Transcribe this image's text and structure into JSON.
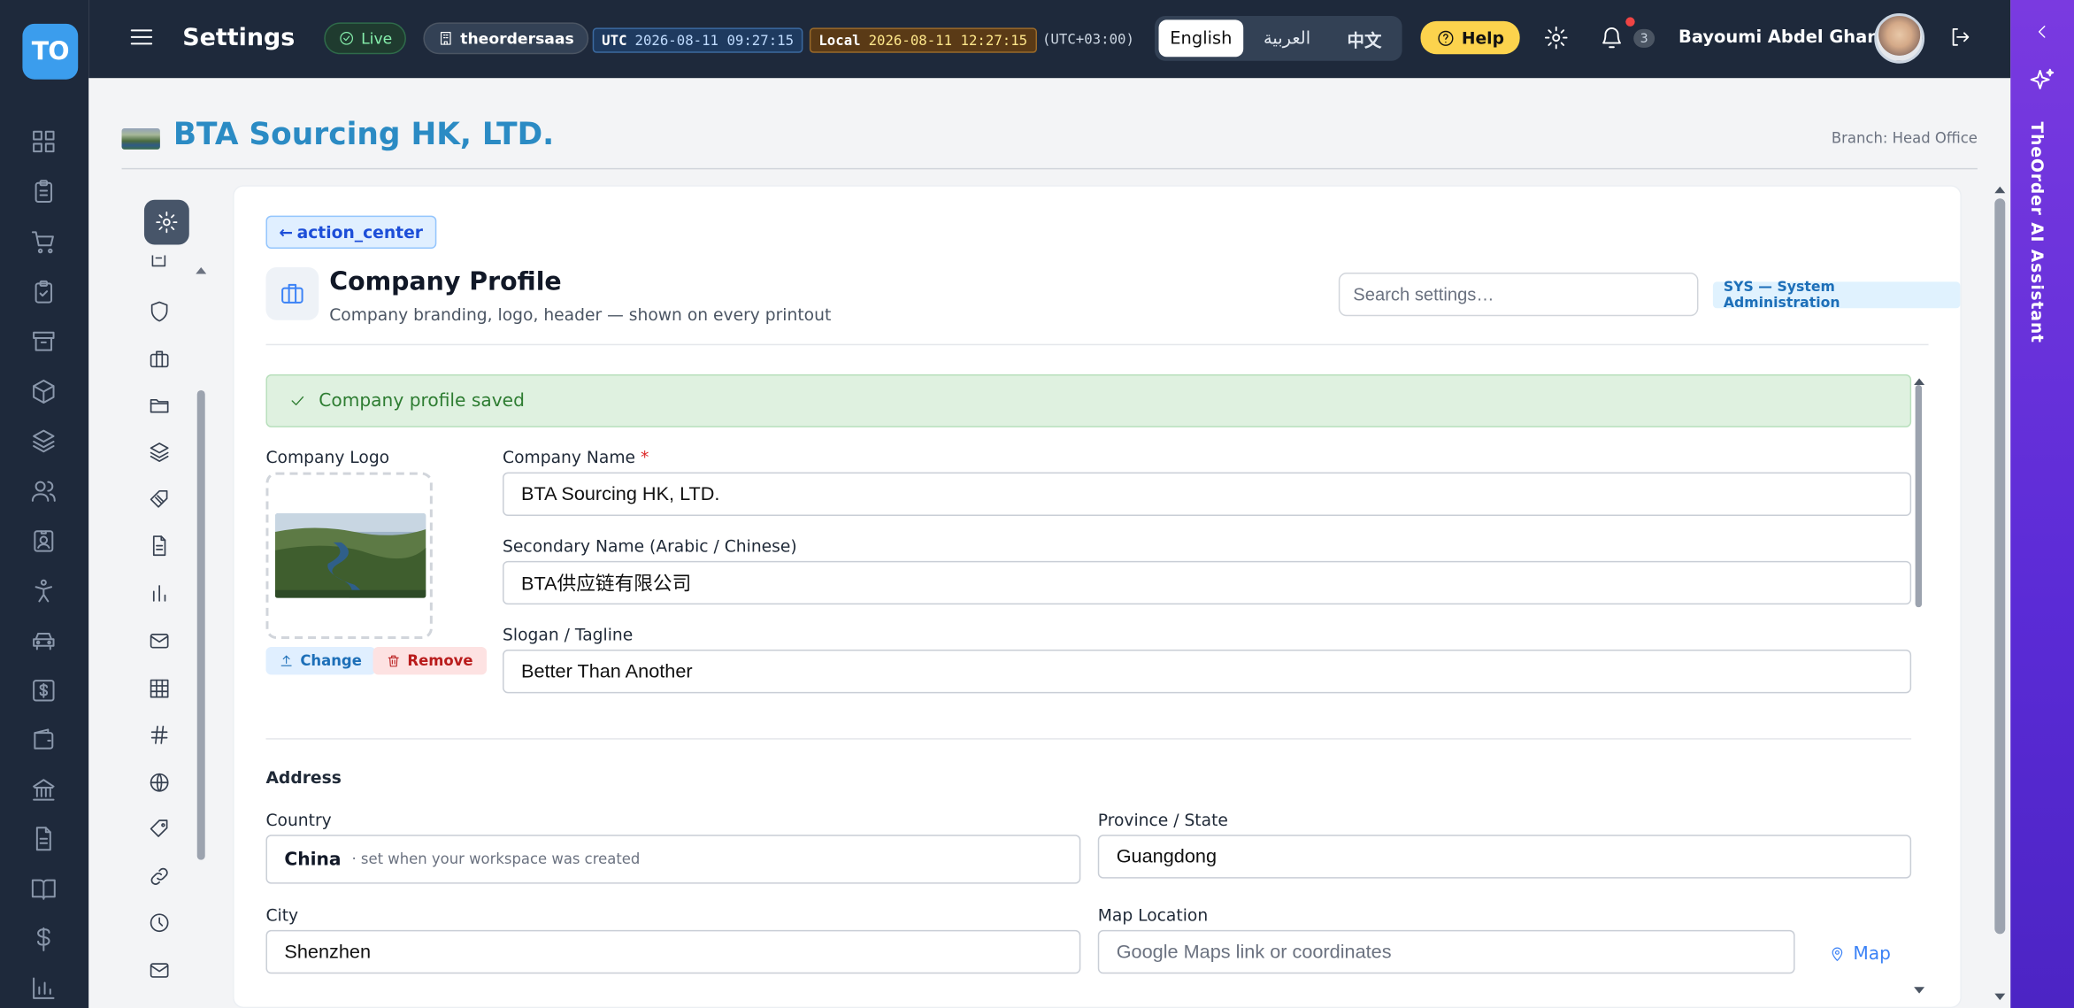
{
  "app": {
    "logo_text": "TO",
    "page_title": "Settings"
  },
  "topbar": {
    "status": "Live",
    "workspace": "theordersaas",
    "utc_label": "UTC",
    "utc_time": "2026-08-11 09:27:15",
    "local_label": "Local",
    "local_time": "2026-08-11 12:27:15",
    "offset": "(UTC+03:00)",
    "languages": [
      "English",
      "العربية",
      "中文"
    ],
    "active_language": "English",
    "help": "Help",
    "notification_count": "3",
    "user_name": "Bayoumi Abdel Ghani"
  },
  "company": {
    "name": "BTA Sourcing HK, LTD.",
    "branch": "Branch: Head Office"
  },
  "panel": {
    "back_label": "action_center",
    "title": "Company Profile",
    "subtitle": "Company branding, logo, header — shown on every printout",
    "search_placeholder": "Search settings…",
    "module_badge": "SYS — System Administration",
    "alert": "Company profile saved"
  },
  "form": {
    "logo_label": "Company Logo",
    "change": "Change",
    "remove": "Remove",
    "name_label": "Company Name",
    "name_required": "*",
    "name_value": "BTA Sourcing HK, LTD.",
    "secondary_label": "Secondary Name (Arabic / Chinese)",
    "secondary_value": "BTA供应链有限公司",
    "slogan_label": "Slogan / Tagline",
    "slogan_value": "Better Than Another",
    "address_heading": "Address",
    "country_label": "Country",
    "country_value": "China",
    "country_note": "· set when your workspace was created",
    "province_label": "Province / State",
    "province_value": "Guangdong",
    "city_label": "City",
    "city_value": "Shenzhen",
    "map_label": "Map Location",
    "map_placeholder": "Google Maps link or coordinates",
    "map_button": "Map"
  },
  "ai_panel": {
    "title": "TheOrder AI Assistant"
  },
  "icons": {
    "rail": [
      "dashboard-icon",
      "clipboard-icon",
      "cart-icon",
      "clipboard-check-icon",
      "archive-icon",
      "box-icon",
      "layers-icon",
      "users-icon",
      "id-card-icon",
      "accessibility-icon",
      "car-icon",
      "dollar-square-icon",
      "wallet-icon",
      "bank-icon",
      "file-text-icon",
      "book-icon",
      "dollar-icon",
      "bar-chart-icon"
    ],
    "settings_nav": [
      "shield-icon",
      "briefcase-icon",
      "folder-icon",
      "layers-icon",
      "tag-icon",
      "file-text-icon",
      "bar-chart-icon",
      "mail-icon",
      "grid-icon",
      "hash-icon",
      "globe-icon",
      "tag-icon",
      "link-icon",
      "clock-icon",
      "mail-icon"
    ]
  },
  "colors": {
    "brand": "#2b8bc4",
    "rail_bg": "#1e293b",
    "ai_panel": "#6d35df",
    "success_bg": "#dff1e0",
    "help_bg": "#fcd34d"
  }
}
